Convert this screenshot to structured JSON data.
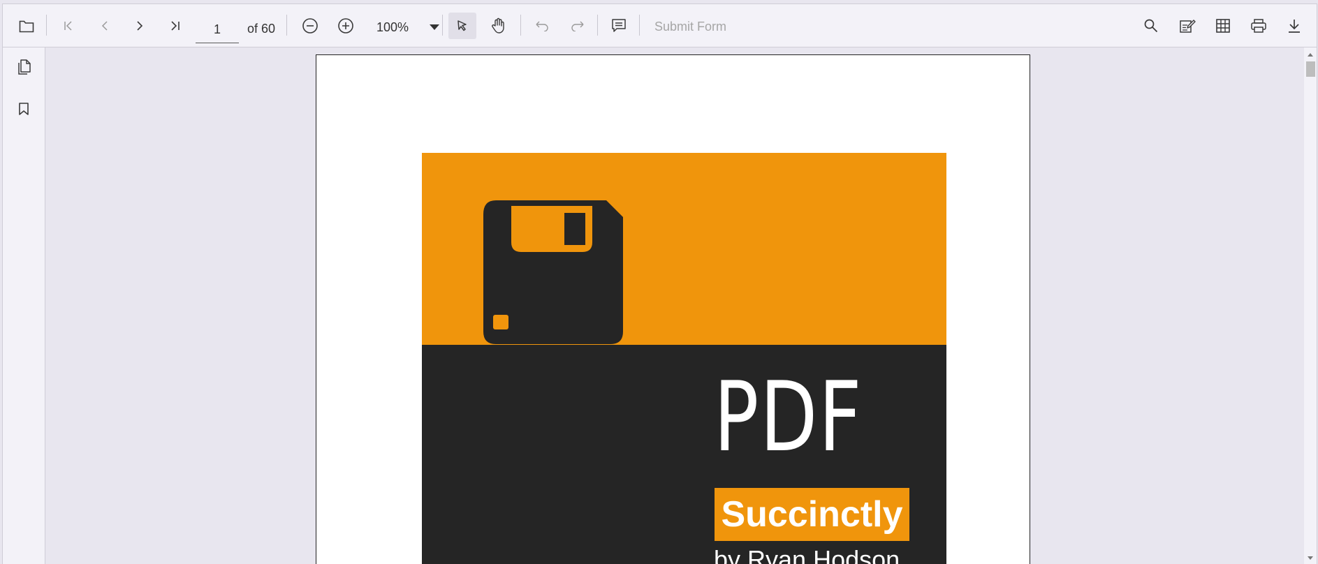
{
  "toolbar": {
    "current_page": "1",
    "total_pages_label": "of 60",
    "zoom_value": "100%",
    "submit_label": "Submit Form",
    "icons": [
      "open-folder-icon",
      "first-page-icon",
      "previous-page-icon",
      "next-page-icon",
      "last-page-icon",
      "zoom-out-icon",
      "zoom-in-icon",
      "text-select-icon",
      "pan-hand-icon",
      "undo-icon",
      "redo-icon",
      "comment-icon",
      "search-icon",
      "annotation-edit-icon",
      "form-designer-icon",
      "print-icon",
      "download-icon"
    ]
  },
  "sidebar": {
    "icons": [
      "page-thumbnails-icon",
      "bookmark-icon"
    ]
  },
  "document": {
    "cover_title": "PDF",
    "series_label": "Succinctly",
    "author_line": "by Ryan Hodson"
  },
  "colors": {
    "accent_orange": "#f0950c",
    "cover_dark": "#252525",
    "toolbar_bg": "#f3f2f8",
    "viewer_bg": "#e8e6ef"
  }
}
